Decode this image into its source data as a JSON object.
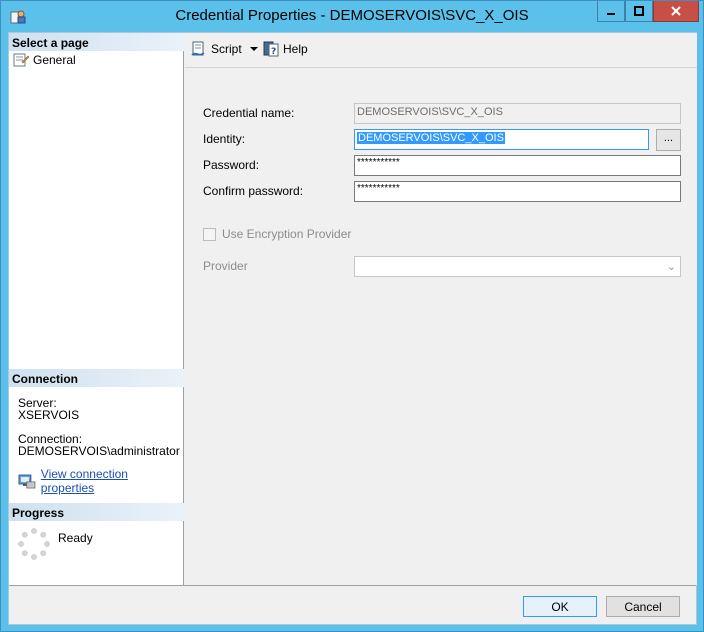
{
  "window": {
    "title": "Credential Properties - DEMOSERVOIS\\SVC_X_OIS"
  },
  "sidebar": {
    "select_page_header": "Select a page",
    "items": [
      {
        "label": "General",
        "icon": "page-properties-icon"
      }
    ],
    "connection_header": "Connection",
    "server_label": "Server:",
    "server_value": "XSERVOIS",
    "connection_label": "Connection:",
    "connection_value": "DEMOSERVOIS\\administrator",
    "view_connection_link": "View connection properties",
    "progress_header": "Progress",
    "progress_status": "Ready"
  },
  "toolbar": {
    "script_label": "Script",
    "help_label": "Help"
  },
  "form": {
    "credential_name_label": "Credential name:",
    "credential_name_value": "DEMOSERVOIS\\SVC_X_OIS",
    "identity_label": "Identity:",
    "identity_value": "DEMOSERVOIS\\SVC_X_OIS",
    "browse_label": "...",
    "password_label": "Password:",
    "password_value": "***********",
    "confirm_password_label": "Confirm password:",
    "confirm_password_value": "***********",
    "use_encryption_label": "Use Encryption Provider",
    "use_encryption_checked": false,
    "provider_label": "Provider",
    "provider_value": ""
  },
  "buttons": {
    "ok_label": "OK",
    "cancel_label": "Cancel"
  },
  "colors": {
    "titlebar": "#5bc0ea",
    "close_button": "#c74f45",
    "selection": "#3399ff",
    "link": "#1a4fb3"
  }
}
